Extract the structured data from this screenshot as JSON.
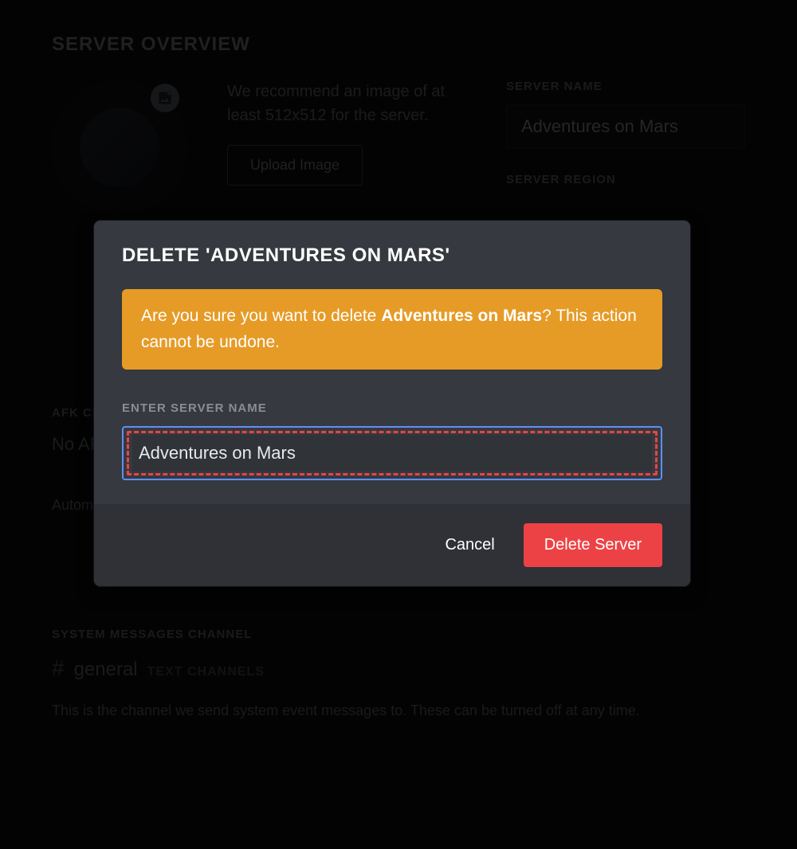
{
  "page": {
    "title": "SERVER OVERVIEW",
    "image_recommend": "We recommend an image of at least 512x512 for the server.",
    "upload_button": "Upload Image",
    "server_name_label": "SERVER NAME",
    "server_name_value": "Adventures on Mars",
    "server_region_label": "SERVER REGION",
    "afk_channel_label": "AFK CHANNEL",
    "afk_channel_value": "No AFK Channel",
    "afk_help": "Automatically move members to this channel when idle for longer than the AFK timeout.",
    "system_channel_label": "SYSTEM MESSAGES CHANNEL",
    "system_channel_hash": "#",
    "system_channel_name": "general",
    "system_channel_cat": "TEXT CHANNELS",
    "system_help": "This is the channel we send system event messages to. These can be turned off at any time."
  },
  "modal": {
    "title": "DELETE 'ADVENTURES ON MARS'",
    "warning_prefix": "Are you sure you want to delete ",
    "warning_server_name": "Adventures on Mars",
    "warning_suffix": "? This action cannot be undone.",
    "enter_label": "ENTER SERVER NAME",
    "confirm_value": "Adventures on Mars",
    "cancel_label": "Cancel",
    "delete_label": "Delete Server"
  },
  "colors": {
    "warning_bg": "#e69b27",
    "danger": "#ed4245",
    "highlight_border": "#5f8ff7",
    "dash_border": "#e84545"
  }
}
